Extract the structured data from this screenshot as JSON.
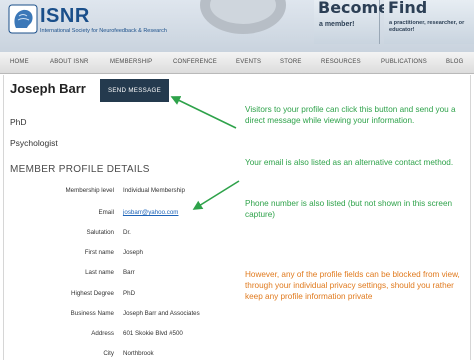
{
  "header": {
    "logo_text": "ISNR",
    "tagline": "International Society for Neurofeedback & Research",
    "become_title": "Become",
    "become_sub": "a member!",
    "find_title": "Find",
    "find_sub": "a practitioner, researcher, or educator!"
  },
  "nav": {
    "items": [
      "HOME",
      "ABOUT ISNR",
      "MEMBERSHIP",
      "CONFERENCE",
      "EVENTS",
      "STORE",
      "RESOURCES",
      "PUBLICATIONS",
      "BLOG"
    ]
  },
  "profile": {
    "name": "Joseph Barr",
    "send_button": "SEND MESSAGE",
    "degree_line": "PhD",
    "title_line": "Psychologist",
    "details_heading": "MEMBER PROFILE DETAILS",
    "fields": [
      {
        "label": "Membership level",
        "value": "Individual Membership"
      },
      {
        "label": "Email",
        "value": "josbarr@yahoo.com"
      },
      {
        "label": "Salutation",
        "value": "Dr."
      },
      {
        "label": "First name",
        "value": "Joseph"
      },
      {
        "label": "Last name",
        "value": "Barr"
      },
      {
        "label": "Highest Degree",
        "value": "PhD"
      },
      {
        "label": "Business Name",
        "value": "Joseph Barr and Associates"
      },
      {
        "label": "Address",
        "value": "601 Skokie Blvd #500"
      },
      {
        "label": "City",
        "value": "Northbrook"
      }
    ]
  },
  "annotations": {
    "button_note": "Visitors to your profile can click this button and send you a direct message while viewing your information.",
    "email_note": "Your  email is also listed as an alternative contact method.",
    "phone_note": "Phone number is also listed (but not shown in this screen capture)",
    "privacy_note": "However, any of the profile fields can be blocked from view, through your individual privacy settings, should you rather keep any profile information private"
  },
  "colors": {
    "annotation_green": "#2ea24a",
    "annotation_orange": "#e07a1e",
    "button_navy": "#243a4e",
    "link_blue": "#1b62b7"
  }
}
